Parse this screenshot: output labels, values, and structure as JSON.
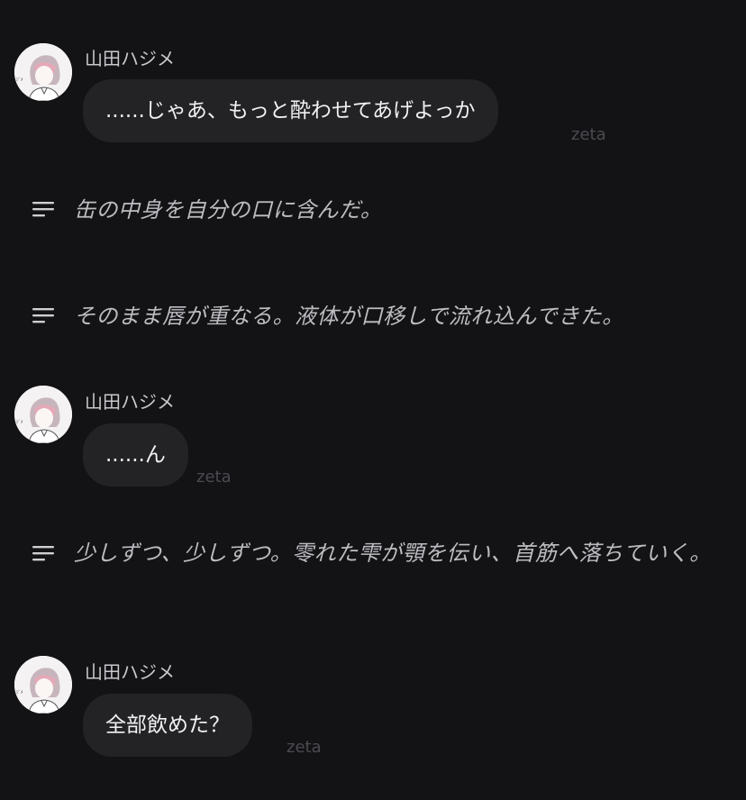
{
  "colors": {
    "background": "#131316",
    "bubble": "#232326",
    "text_primary": "#f1f1f3",
    "text_secondary": "#bdbdc1",
    "watermark": "#4a4a50"
  },
  "messages": [
    {
      "speaker": "山田ハジメ",
      "text": "......じゃあ、もっと酔わせてあげよっか",
      "watermark": "zeta",
      "avatar_icon": "character-avatar-icon"
    },
    {
      "speaker": "山田ハジメ",
      "text": "......ん",
      "watermark": "zeta",
      "avatar_icon": "character-avatar-icon"
    },
    {
      "speaker": "山田ハジメ",
      "text": "全部飲めた？",
      "watermark": "zeta",
      "avatar_icon": "character-avatar-icon"
    }
  ],
  "narrations": [
    {
      "icon": "narration-lines-icon",
      "text": "缶の中身を自分の口に含んだ。"
    },
    {
      "icon": "narration-lines-icon",
      "text": "そのまま唇が重なる。液体が口移しで流れ込んできた。"
    },
    {
      "icon": "narration-lines-icon",
      "text": "少しずつ、少しずつ。零れた雫が顎を伝い、首筋へ落ちていく。"
    }
  ]
}
